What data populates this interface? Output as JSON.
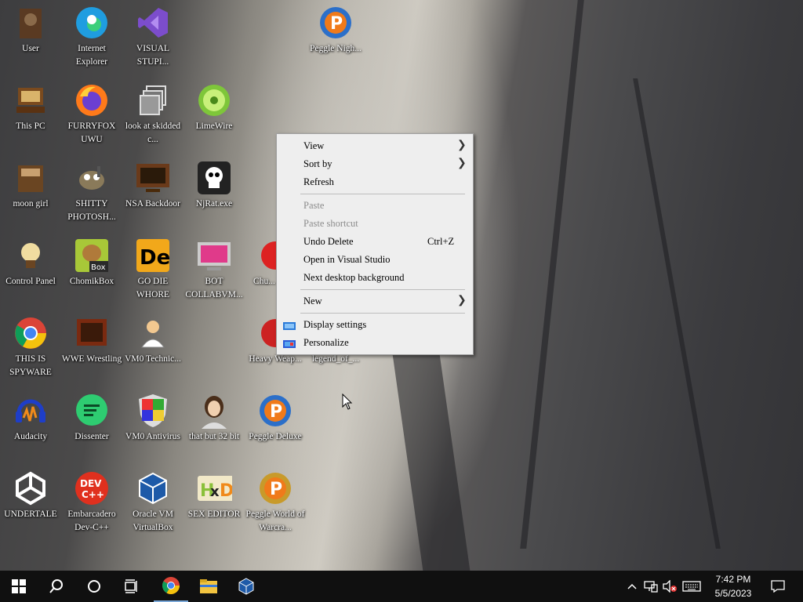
{
  "desktop": {
    "icons": [
      {
        "label": "User"
      },
      {
        "label": "Internet Explorer"
      },
      {
        "label": "VISUAL STUPI..."
      },
      {
        "label": "Peggle Nigh..."
      },
      {
        "label": "This PC"
      },
      {
        "label": "FURRYFOX UWU"
      },
      {
        "label": "look at skidded c..."
      },
      {
        "label": "LimeWire"
      },
      {
        "label": "moon girl"
      },
      {
        "label": "SHITTY PHOTOSH..."
      },
      {
        "label": "NSA Backdoor"
      },
      {
        "label": "NjRat.exe"
      },
      {
        "label": "Control Panel"
      },
      {
        "label": "ChomikBox"
      },
      {
        "label": "GO DIE WHORE"
      },
      {
        "label": "BOT COLLABVM..."
      },
      {
        "label": "Chu... Del..."
      },
      {
        "label": "THIS IS SPYWARE"
      },
      {
        "label": "WWE Wrestling"
      },
      {
        "label": "VM0 Technic..."
      },
      {
        "label": "Heavy Weap..."
      },
      {
        "label": "legend_of_..."
      },
      {
        "label": "Audacity"
      },
      {
        "label": "Dissenter"
      },
      {
        "label": "VM0 Antivirus"
      },
      {
        "label": "that but 32 bit"
      },
      {
        "label": "Peggle Deluxe"
      },
      {
        "label": "UNDERTALE"
      },
      {
        "label": "Embarcadero Dev-C++"
      },
      {
        "label": "Oracle VM VirtualBox"
      },
      {
        "label": "SEX EDITOR"
      },
      {
        "label": "Peggle World of Warcra..."
      }
    ]
  },
  "context_menu": {
    "view": "View",
    "sort_by": "Sort by",
    "refresh": "Refresh",
    "paste": "Paste",
    "paste_shortcut": "Paste shortcut",
    "undo_delete": "Undo Delete",
    "undo_shortcut": "Ctrl+Z",
    "open_vs": "Open in Visual Studio",
    "next_bg": "Next desktop background",
    "new": "New",
    "display_settings": "Display settings",
    "personalize": "Personalize"
  },
  "taskbar": {
    "time": "7:42 PM",
    "date": "5/5/2023"
  },
  "colors": {
    "taskbar": "#101010",
    "menu_bg": "#eeeeee",
    "accent": "#0078d7"
  }
}
